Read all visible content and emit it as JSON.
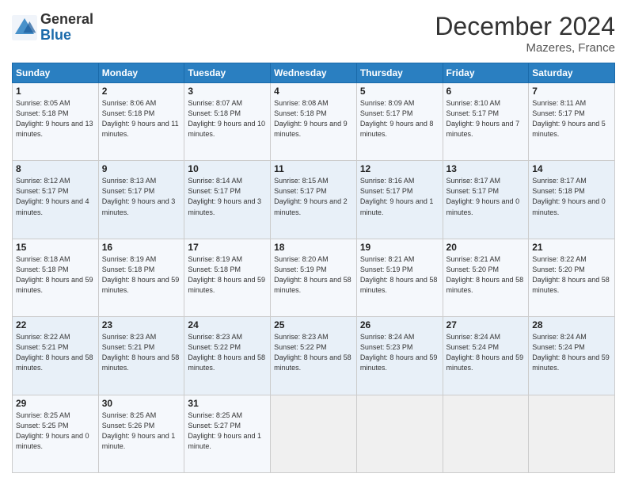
{
  "header": {
    "logo_general": "General",
    "logo_blue": "Blue",
    "month_title": "December 2024",
    "location": "Mazeres, France"
  },
  "days_of_week": [
    "Sunday",
    "Monday",
    "Tuesday",
    "Wednesday",
    "Thursday",
    "Friday",
    "Saturday"
  ],
  "weeks": [
    [
      {
        "day": "1",
        "sunrise": "Sunrise: 8:05 AM",
        "sunset": "Sunset: 5:18 PM",
        "daylight": "Daylight: 9 hours and 13 minutes."
      },
      {
        "day": "2",
        "sunrise": "Sunrise: 8:06 AM",
        "sunset": "Sunset: 5:18 PM",
        "daylight": "Daylight: 9 hours and 11 minutes."
      },
      {
        "day": "3",
        "sunrise": "Sunrise: 8:07 AM",
        "sunset": "Sunset: 5:18 PM",
        "daylight": "Daylight: 9 hours and 10 minutes."
      },
      {
        "day": "4",
        "sunrise": "Sunrise: 8:08 AM",
        "sunset": "Sunset: 5:18 PM",
        "daylight": "Daylight: 9 hours and 9 minutes."
      },
      {
        "day": "5",
        "sunrise": "Sunrise: 8:09 AM",
        "sunset": "Sunset: 5:17 PM",
        "daylight": "Daylight: 9 hours and 8 minutes."
      },
      {
        "day": "6",
        "sunrise": "Sunrise: 8:10 AM",
        "sunset": "Sunset: 5:17 PM",
        "daylight": "Daylight: 9 hours and 7 minutes."
      },
      {
        "day": "7",
        "sunrise": "Sunrise: 8:11 AM",
        "sunset": "Sunset: 5:17 PM",
        "daylight": "Daylight: 9 hours and 5 minutes."
      }
    ],
    [
      {
        "day": "8",
        "sunrise": "Sunrise: 8:12 AM",
        "sunset": "Sunset: 5:17 PM",
        "daylight": "Daylight: 9 hours and 4 minutes."
      },
      {
        "day": "9",
        "sunrise": "Sunrise: 8:13 AM",
        "sunset": "Sunset: 5:17 PM",
        "daylight": "Daylight: 9 hours and 3 minutes."
      },
      {
        "day": "10",
        "sunrise": "Sunrise: 8:14 AM",
        "sunset": "Sunset: 5:17 PM",
        "daylight": "Daylight: 9 hours and 3 minutes."
      },
      {
        "day": "11",
        "sunrise": "Sunrise: 8:15 AM",
        "sunset": "Sunset: 5:17 PM",
        "daylight": "Daylight: 9 hours and 2 minutes."
      },
      {
        "day": "12",
        "sunrise": "Sunrise: 8:16 AM",
        "sunset": "Sunset: 5:17 PM",
        "daylight": "Daylight: 9 hours and 1 minute."
      },
      {
        "day": "13",
        "sunrise": "Sunrise: 8:17 AM",
        "sunset": "Sunset: 5:17 PM",
        "daylight": "Daylight: 9 hours and 0 minutes."
      },
      {
        "day": "14",
        "sunrise": "Sunrise: 8:17 AM",
        "sunset": "Sunset: 5:18 PM",
        "daylight": "Daylight: 9 hours and 0 minutes."
      }
    ],
    [
      {
        "day": "15",
        "sunrise": "Sunrise: 8:18 AM",
        "sunset": "Sunset: 5:18 PM",
        "daylight": "Daylight: 8 hours and 59 minutes."
      },
      {
        "day": "16",
        "sunrise": "Sunrise: 8:19 AM",
        "sunset": "Sunset: 5:18 PM",
        "daylight": "Daylight: 8 hours and 59 minutes."
      },
      {
        "day": "17",
        "sunrise": "Sunrise: 8:19 AM",
        "sunset": "Sunset: 5:18 PM",
        "daylight": "Daylight: 8 hours and 59 minutes."
      },
      {
        "day": "18",
        "sunrise": "Sunrise: 8:20 AM",
        "sunset": "Sunset: 5:19 PM",
        "daylight": "Daylight: 8 hours and 58 minutes."
      },
      {
        "day": "19",
        "sunrise": "Sunrise: 8:21 AM",
        "sunset": "Sunset: 5:19 PM",
        "daylight": "Daylight: 8 hours and 58 minutes."
      },
      {
        "day": "20",
        "sunrise": "Sunrise: 8:21 AM",
        "sunset": "Sunset: 5:20 PM",
        "daylight": "Daylight: 8 hours and 58 minutes."
      },
      {
        "day": "21",
        "sunrise": "Sunrise: 8:22 AM",
        "sunset": "Sunset: 5:20 PM",
        "daylight": "Daylight: 8 hours and 58 minutes."
      }
    ],
    [
      {
        "day": "22",
        "sunrise": "Sunrise: 8:22 AM",
        "sunset": "Sunset: 5:21 PM",
        "daylight": "Daylight: 8 hours and 58 minutes."
      },
      {
        "day": "23",
        "sunrise": "Sunrise: 8:23 AM",
        "sunset": "Sunset: 5:21 PM",
        "daylight": "Daylight: 8 hours and 58 minutes."
      },
      {
        "day": "24",
        "sunrise": "Sunrise: 8:23 AM",
        "sunset": "Sunset: 5:22 PM",
        "daylight": "Daylight: 8 hours and 58 minutes."
      },
      {
        "day": "25",
        "sunrise": "Sunrise: 8:23 AM",
        "sunset": "Sunset: 5:22 PM",
        "daylight": "Daylight: 8 hours and 58 minutes."
      },
      {
        "day": "26",
        "sunrise": "Sunrise: 8:24 AM",
        "sunset": "Sunset: 5:23 PM",
        "daylight": "Daylight: 8 hours and 59 minutes."
      },
      {
        "day": "27",
        "sunrise": "Sunrise: 8:24 AM",
        "sunset": "Sunset: 5:24 PM",
        "daylight": "Daylight: 8 hours and 59 minutes."
      },
      {
        "day": "28",
        "sunrise": "Sunrise: 8:24 AM",
        "sunset": "Sunset: 5:24 PM",
        "daylight": "Daylight: 8 hours and 59 minutes."
      }
    ],
    [
      {
        "day": "29",
        "sunrise": "Sunrise: 8:25 AM",
        "sunset": "Sunset: 5:25 PM",
        "daylight": "Daylight: 9 hours and 0 minutes."
      },
      {
        "day": "30",
        "sunrise": "Sunrise: 8:25 AM",
        "sunset": "Sunset: 5:26 PM",
        "daylight": "Daylight: 9 hours and 1 minute."
      },
      {
        "day": "31",
        "sunrise": "Sunrise: 8:25 AM",
        "sunset": "Sunset: 5:27 PM",
        "daylight": "Daylight: 9 hours and 1 minute."
      },
      null,
      null,
      null,
      null
    ]
  ]
}
